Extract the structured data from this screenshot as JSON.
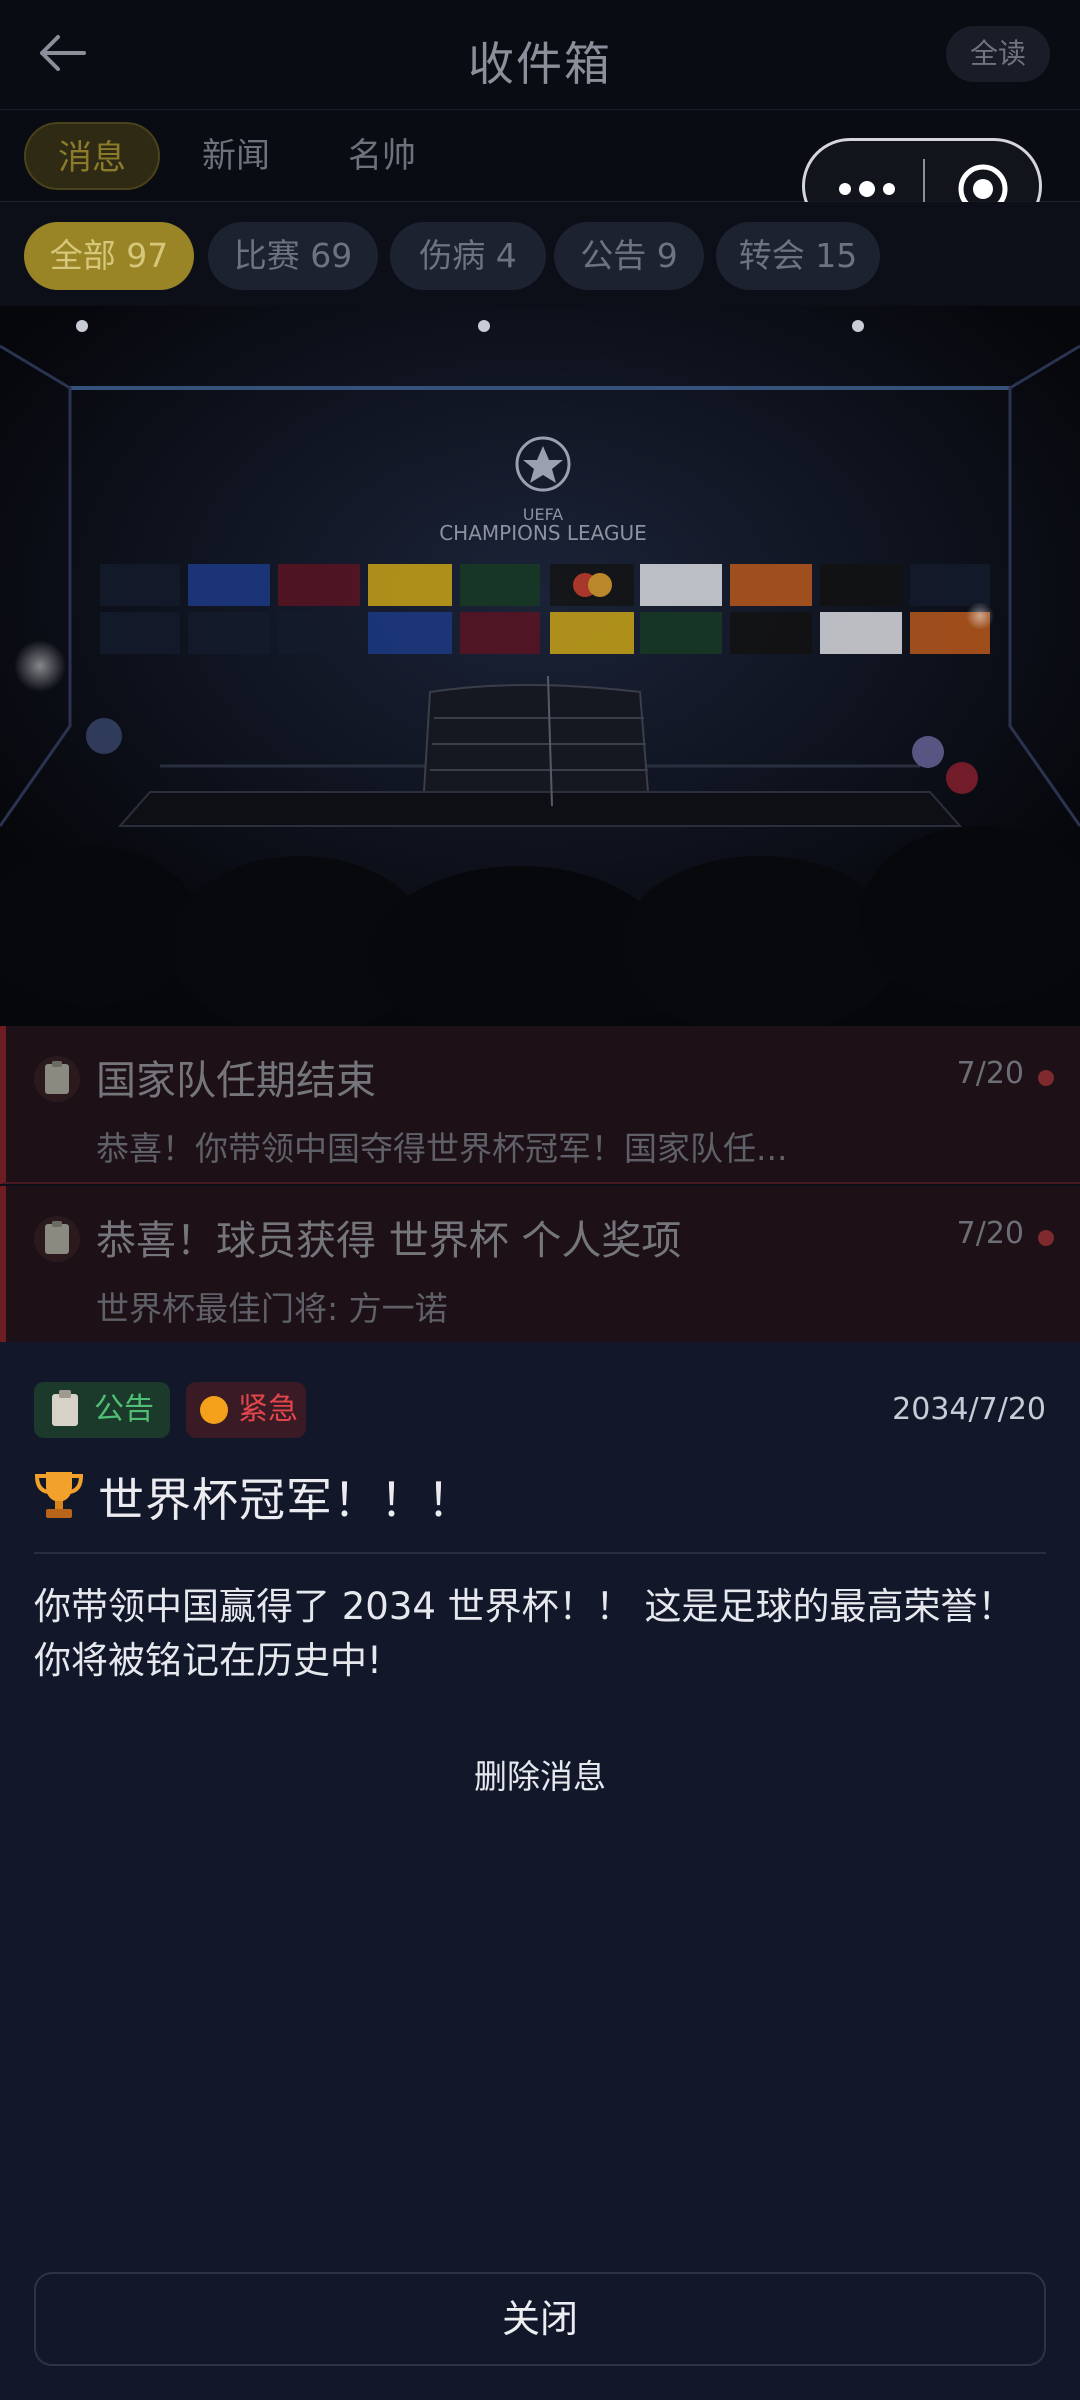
{
  "header": {
    "title": "收件箱",
    "read_all_label": "全读"
  },
  "tabs": [
    {
      "label": "消息",
      "active": true
    },
    {
      "label": "新闻"
    },
    {
      "label": "名帅"
    }
  ],
  "filters": [
    {
      "label": "全部 97",
      "active": true
    },
    {
      "label": "比赛 69"
    },
    {
      "label": "伤病 4"
    },
    {
      "label": "公告 9"
    },
    {
      "label": "转会 15"
    }
  ],
  "scene": {
    "league_name": "CHAMPIONS LEAGUE",
    "league_prefix": "UEFA"
  },
  "messages": [
    {
      "title": "国家队任期结束",
      "date": "7/20",
      "preview": "恭喜！你带领中国夺得世界杯冠军！国家队任..."
    },
    {
      "title": "恭喜！球员获得 世界杯 个人奖项",
      "date": "7/20",
      "preview": "世界杯最佳门将: 方一诺"
    }
  ],
  "detail": {
    "category_label": "公告",
    "priority_label": "紧急",
    "date": "2034/7/20",
    "title": "世界杯冠军！！！",
    "body": "你带领中国赢得了 2034 世界杯！！ 这是足球的最高荣誉！ 你将被铭记在历史中!",
    "delete_label": "删除消息",
    "close_label": "关闭"
  },
  "colors": {
    "accent_gold": "#9a8526",
    "urgent_red": "#e1464b",
    "announce_green": "#4fbf75",
    "panel_bg": "#12182a"
  }
}
